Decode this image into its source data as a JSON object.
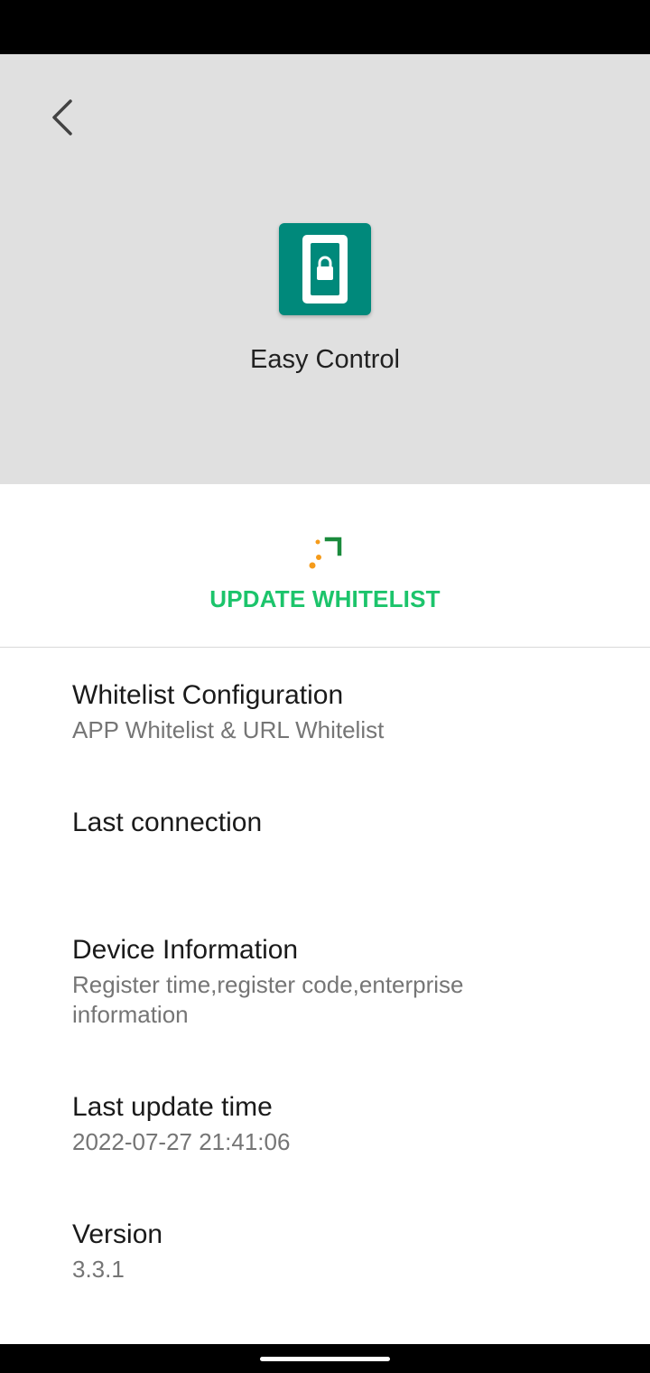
{
  "header": {
    "app_name": "Easy Control",
    "back_icon": "chevron-left-icon",
    "app_icon": "phone-lock-icon",
    "accent_color": "#00897b"
  },
  "update": {
    "label": "UPDATE WHITELIST",
    "icon": "sync-progress-icon",
    "label_color": "#1cc46b"
  },
  "settings": {
    "items": [
      {
        "title": "Whitelist Configuration",
        "summary": "APP Whitelist & URL Whitelist"
      },
      {
        "title": "Last connection",
        "summary": ""
      },
      {
        "title": "Device Information",
        "summary": "Register time,register code,enterprise information"
      },
      {
        "title": "Last update time",
        "summary": "2022-07-27 21:41:06"
      },
      {
        "title": "Version",
        "summary": "3.3.1"
      }
    ]
  }
}
